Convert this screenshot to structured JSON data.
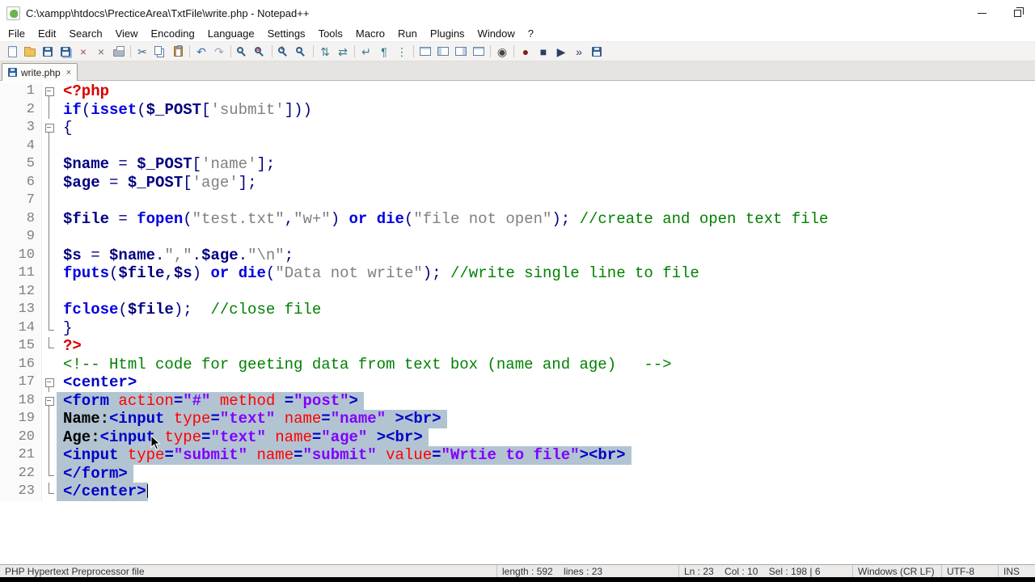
{
  "colors": {
    "sel": "#B2C4D2",
    "php": "#D80000",
    "kw": "#0000E0",
    "var": "#000080",
    "str": "#808080",
    "com": "#008000",
    "tag": "#0000C8",
    "attr": "#FF0000",
    "val": "#8000FF"
  },
  "window": {
    "title": "C:\\xampp\\htdocs\\PrecticeArea\\TxtFile\\write.php - Notepad++"
  },
  "menu": {
    "items": [
      "File",
      "Edit",
      "Search",
      "View",
      "Encoding",
      "Language",
      "Settings",
      "Tools",
      "Macro",
      "Run",
      "Plugins",
      "Window",
      "?"
    ]
  },
  "toolbar": {
    "groups": [
      [
        {
          "name": "new-file-icon",
          "cls": "ic-doc"
        },
        {
          "name": "open-file-icon",
          "cls": "ic-folder"
        },
        {
          "name": "save-icon",
          "cls": "ic-floppy"
        },
        {
          "name": "save-all-icon",
          "cls": "ic-floppy ic-multi"
        },
        {
          "name": "close-file-icon",
          "glyph": "×",
          "color": "#a04848"
        },
        {
          "name": "close-all-icon",
          "glyph": "×",
          "color": "#6b6b6b"
        },
        {
          "name": "print-icon",
          "cls": "ic-print"
        }
      ],
      [
        {
          "name": "cut-icon",
          "glyph": "✂",
          "color": "#44617e"
        },
        {
          "name": "copy-icon",
          "cls": "ic-copy"
        },
        {
          "name": "paste-icon",
          "cls": "ic-paste"
        }
      ],
      [
        {
          "name": "undo-icon",
          "glyph": "↶",
          "color": "#2f6db4"
        },
        {
          "name": "redo-icon",
          "glyph": "↷",
          "color": "#9aa4ad"
        }
      ],
      [
        {
          "name": "find-icon",
          "cls": "ic-search"
        },
        {
          "name": "replace-icon",
          "cls": "ic-search ic-replace"
        }
      ],
      [
        {
          "name": "zoom-in-icon",
          "cls": "ic-search ic-zin"
        },
        {
          "name": "zoom-out-icon",
          "cls": "ic-search ic-zout"
        }
      ],
      [
        {
          "name": "sync-scroll-vertical-icon",
          "glyph": "⇅",
          "color": "#3a7d8c"
        },
        {
          "name": "sync-scroll-horizontal-icon",
          "glyph": "⇄",
          "color": "#3a7d8c"
        }
      ],
      [
        {
          "name": "word-wrap-icon",
          "glyph": "↵",
          "color": "#3a7d8c"
        },
        {
          "name": "show-all-characters-icon",
          "glyph": "¶",
          "color": "#3a7d8c"
        },
        {
          "name": "indent-guide-icon",
          "glyph": "⋮",
          "color": "#3a7d8c"
        }
      ],
      [
        {
          "name": "function-list-icon",
          "cls": "ic-panel"
        },
        {
          "name": "folder-as-workspace-icon",
          "cls": "ic-panel ic-panel-left"
        },
        {
          "name": "document-map-icon",
          "cls": "ic-panel ic-panel-right"
        },
        {
          "name": "document-list-icon",
          "cls": "ic-panel"
        }
      ],
      [
        {
          "name": "monitoring-icon",
          "glyph": "◉",
          "color": "#444444"
        }
      ],
      [
        {
          "name": "record-macro-icon",
          "glyph": "●",
          "color": "#8b1a1a"
        },
        {
          "name": "stop-macro-icon",
          "glyph": "■",
          "color": "#2c3e66"
        },
        {
          "name": "play-macro-icon",
          "glyph": "▶",
          "color": "#2c3e66"
        },
        {
          "name": "run-macro-multiple-icon",
          "glyph": "»",
          "color": "#2c3e66"
        },
        {
          "name": "save-macro-icon",
          "cls": "ic-floppy"
        }
      ]
    ]
  },
  "tabs": {
    "active": {
      "label": "write.php",
      "close_glyph": "×"
    }
  },
  "editor": {
    "lines": [
      {
        "n": 1,
        "f": "box",
        "seg": [
          {
            "t": "<?php",
            "c": "php"
          }
        ]
      },
      {
        "n": 2,
        "f": "line",
        "seg": [
          {
            "t": "if",
            "c": "kw"
          },
          {
            "t": "(",
            "c": "op"
          },
          {
            "t": "isset",
            "c": "kw"
          },
          {
            "t": "(",
            "c": "op"
          },
          {
            "t": "$_POST",
            "c": "var"
          },
          {
            "t": "[",
            "c": "op"
          },
          {
            "t": "'submit'",
            "c": "str"
          },
          {
            "t": "]))",
            "c": "op"
          }
        ]
      },
      {
        "n": 3,
        "f": "box",
        "seg": [
          {
            "t": "{",
            "c": "op"
          }
        ]
      },
      {
        "n": 4,
        "f": "line",
        "seg": []
      },
      {
        "n": 5,
        "f": "line",
        "seg": [
          {
            "t": "$name",
            "c": "var"
          },
          {
            "t": " = ",
            "c": "op"
          },
          {
            "t": "$_POST",
            "c": "var"
          },
          {
            "t": "[",
            "c": "op"
          },
          {
            "t": "'name'",
            "c": "str"
          },
          {
            "t": "];",
            "c": "op"
          }
        ]
      },
      {
        "n": 6,
        "f": "line",
        "seg": [
          {
            "t": "$age",
            "c": "var"
          },
          {
            "t": " = ",
            "c": "op"
          },
          {
            "t": "$_POST",
            "c": "var"
          },
          {
            "t": "[",
            "c": "op"
          },
          {
            "t": "'age'",
            "c": "str"
          },
          {
            "t": "];",
            "c": "op"
          }
        ]
      },
      {
        "n": 7,
        "f": "line",
        "seg": []
      },
      {
        "n": 8,
        "f": "line",
        "seg": [
          {
            "t": "$file",
            "c": "var"
          },
          {
            "t": " = ",
            "c": "op"
          },
          {
            "t": "fopen",
            "c": "kw"
          },
          {
            "t": "(",
            "c": "op"
          },
          {
            "t": "\"test.txt\"",
            "c": "str"
          },
          {
            "t": ",",
            "c": "op"
          },
          {
            "t": "\"w+\"",
            "c": "str"
          },
          {
            "t": ") ",
            "c": "op"
          },
          {
            "t": "or",
            "c": "kw"
          },
          {
            "t": " ",
            "c": "op"
          },
          {
            "t": "die",
            "c": "kw"
          },
          {
            "t": "(",
            "c": "op"
          },
          {
            "t": "\"file not open\"",
            "c": "str"
          },
          {
            "t": "); ",
            "c": "op"
          },
          {
            "t": "//create and open text file",
            "c": "com"
          }
        ]
      },
      {
        "n": 9,
        "f": "line",
        "seg": []
      },
      {
        "n": 10,
        "f": "line",
        "seg": [
          {
            "t": "$s",
            "c": "var"
          },
          {
            "t": " = ",
            "c": "op"
          },
          {
            "t": "$name",
            "c": "var"
          },
          {
            "t": ".",
            "c": "op"
          },
          {
            "t": "\",\"",
            "c": "str"
          },
          {
            "t": ".",
            "c": "op"
          },
          {
            "t": "$age",
            "c": "var"
          },
          {
            "t": ".",
            "c": "op"
          },
          {
            "t": "\"\\n\"",
            "c": "str"
          },
          {
            "t": ";",
            "c": "op"
          }
        ]
      },
      {
        "n": 11,
        "f": "line",
        "seg": [
          {
            "t": "fputs",
            "c": "kw"
          },
          {
            "t": "(",
            "c": "op"
          },
          {
            "t": "$file",
            "c": "var"
          },
          {
            "t": ",",
            "c": "op"
          },
          {
            "t": "$s",
            "c": "var"
          },
          {
            "t": ") ",
            "c": "op"
          },
          {
            "t": "or",
            "c": "kw"
          },
          {
            "t": " ",
            "c": "op"
          },
          {
            "t": "die",
            "c": "kw"
          },
          {
            "t": "(",
            "c": "op"
          },
          {
            "t": "\"Data not write\"",
            "c": "str"
          },
          {
            "t": "); ",
            "c": "op"
          },
          {
            "t": "//write single line to file",
            "c": "com"
          }
        ]
      },
      {
        "n": 12,
        "f": "line",
        "seg": []
      },
      {
        "n": 13,
        "f": "line",
        "seg": [
          {
            "t": "fclose",
            "c": "kw"
          },
          {
            "t": "(",
            "c": "op"
          },
          {
            "t": "$file",
            "c": "var"
          },
          {
            "t": ");  ",
            "c": "op"
          },
          {
            "t": "//close file",
            "c": "com"
          }
        ]
      },
      {
        "n": 14,
        "f": "end",
        "seg": [
          {
            "t": "}",
            "c": "op"
          }
        ]
      },
      {
        "n": 15,
        "f": "end",
        "seg": [
          {
            "t": "?>",
            "c": "php"
          }
        ]
      },
      {
        "n": 16,
        "f": "",
        "seg": [
          {
            "t": "<!-- Html code for geeting data from text box (name and age)   -->",
            "c": "com"
          }
        ]
      },
      {
        "n": 17,
        "f": "box",
        "seg": [
          {
            "t": "<center>",
            "c": "tag"
          }
        ]
      },
      {
        "n": 18,
        "f": "box",
        "sel": true,
        "selEol": true,
        "seg": [
          {
            "t": "<form ",
            "c": "tag"
          },
          {
            "t": "action",
            "c": "attr"
          },
          {
            "t": "=",
            "c": "tag"
          },
          {
            "t": "\"#\"",
            "c": "val"
          },
          {
            "t": " ",
            "c": "tag"
          },
          {
            "t": "method",
            "c": "attr"
          },
          {
            "t": " =",
            "c": "tag"
          },
          {
            "t": "\"post\"",
            "c": "val"
          },
          {
            "t": ">",
            "c": "tag"
          }
        ]
      },
      {
        "n": 19,
        "f": "line",
        "sel": true,
        "selEol": true,
        "seg": [
          {
            "t": "Name:",
            "c": "txt"
          },
          {
            "t": "<input ",
            "c": "tag"
          },
          {
            "t": "type",
            "c": "attr"
          },
          {
            "t": "=",
            "c": "tag"
          },
          {
            "t": "\"text\"",
            "c": "val"
          },
          {
            "t": " ",
            "c": "tag"
          },
          {
            "t": "name",
            "c": "attr"
          },
          {
            "t": "=",
            "c": "tag"
          },
          {
            "t": "\"name\"",
            "c": "val"
          },
          {
            "t": " >",
            "c": "tag"
          },
          {
            "t": "<br>",
            "c": "tag"
          }
        ]
      },
      {
        "n": 20,
        "f": "line",
        "sel": true,
        "selEol": true,
        "seg": [
          {
            "t": "Age:",
            "c": "txt"
          },
          {
            "t": "<input ",
            "c": "tag"
          },
          {
            "t": "type",
            "c": "attr"
          },
          {
            "t": "=",
            "c": "tag"
          },
          {
            "t": "\"text\"",
            "c": "val"
          },
          {
            "t": " ",
            "c": "tag"
          },
          {
            "t": "name",
            "c": "attr"
          },
          {
            "t": "=",
            "c": "tag"
          },
          {
            "t": "\"age\"",
            "c": "val"
          },
          {
            "t": " >",
            "c": "tag"
          },
          {
            "t": "<br>",
            "c": "tag"
          }
        ]
      },
      {
        "n": 21,
        "f": "line",
        "sel": true,
        "selEol": true,
        "seg": [
          {
            "t": "<input ",
            "c": "tag"
          },
          {
            "t": "type",
            "c": "attr"
          },
          {
            "t": "=",
            "c": "tag"
          },
          {
            "t": "\"submit\"",
            "c": "val"
          },
          {
            "t": " ",
            "c": "tag"
          },
          {
            "t": "name",
            "c": "attr"
          },
          {
            "t": "=",
            "c": "tag"
          },
          {
            "t": "\"submit\"",
            "c": "val"
          },
          {
            "t": " ",
            "c": "tag"
          },
          {
            "t": "value",
            "c": "attr"
          },
          {
            "t": "=",
            "c": "tag"
          },
          {
            "t": "\"Wrtie to file\"",
            "c": "val"
          },
          {
            "t": ">",
            "c": "tag"
          },
          {
            "t": "<br>",
            "c": "tag"
          }
        ]
      },
      {
        "n": 22,
        "f": "end",
        "sel": true,
        "selEol": true,
        "seg": [
          {
            "t": "</form>",
            "c": "tag"
          }
        ]
      },
      {
        "n": 23,
        "f": "end",
        "sel": true,
        "caret": true,
        "seg": [
          {
            "t": "</center>",
            "c": "tag"
          }
        ]
      }
    ]
  },
  "status": {
    "doc_type": "PHP Hypertext Preprocessor file",
    "length_lines": "length : 592    lines : 23",
    "cursor": "Ln : 23    Col : 10    Sel : 198 | 6",
    "eol": "Windows (CR LF)",
    "encoding": "UTF-8",
    "mode": "INS"
  }
}
